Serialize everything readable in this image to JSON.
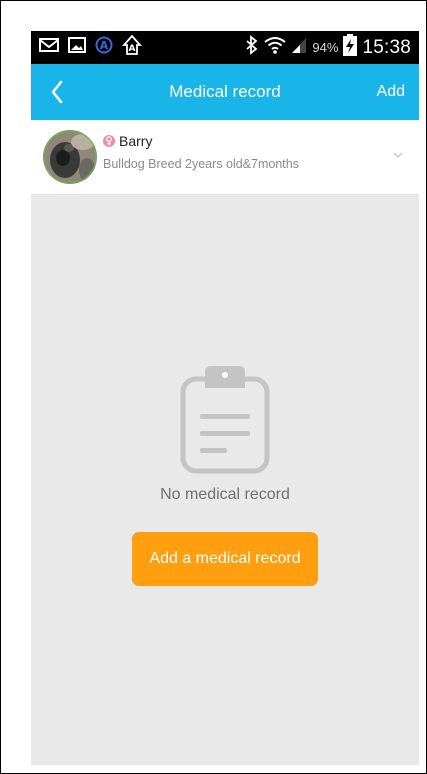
{
  "status_bar": {
    "battery_percent": "94%",
    "time": "15:38",
    "icons_left": [
      "mail-icon",
      "image-icon",
      "a-circle-icon",
      "a-arrow-icon"
    ],
    "icons_right": [
      "bluetooth-icon",
      "wifi-icon",
      "signal-icon",
      "battery-charging-icon"
    ]
  },
  "app_bar": {
    "title": "Medical record",
    "add_label": "Add",
    "color": "#1ab5e8"
  },
  "pet": {
    "name": "Barry",
    "description": "Bulldog Breed 2years old&7months",
    "gender_badge_color": "#f28ba6"
  },
  "empty_state": {
    "icon": "clipboard-icon",
    "message": "No medical record",
    "button_label": "Add a medical record",
    "button_color": "#ff9e0f"
  }
}
